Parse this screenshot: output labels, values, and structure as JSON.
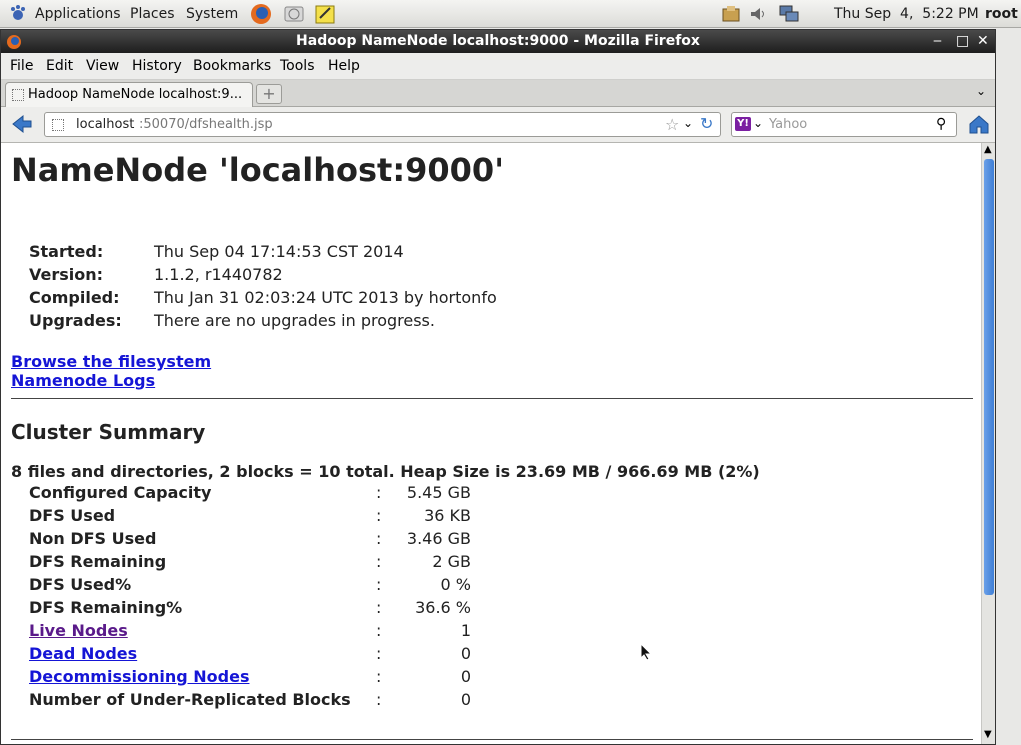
{
  "panel": {
    "applications": "Applications",
    "places": "Places",
    "system": "System",
    "clock": "Thu Sep  4,  5:22 PM",
    "user": "root"
  },
  "window": {
    "title": "Hadoop NameNode localhost:9000 - Mozilla Firefox"
  },
  "menubar": {
    "file": "File",
    "edit": "Edit",
    "view": "View",
    "history": "History",
    "bookmarks": "Bookmarks",
    "tools": "Tools",
    "help": "Help"
  },
  "tab": {
    "label": "Hadoop NameNode localhost:9..."
  },
  "navbar": {
    "url_host": "localhost",
    "url_path": ":50070/dfshealth.jsp",
    "search_placeholder": "Yahoo"
  },
  "page": {
    "title": "NameNode 'localhost:9000'",
    "info": [
      {
        "label": "Started:",
        "value": "Thu Sep 04 17:14:53 CST 2014"
      },
      {
        "label": "Version:",
        "value": "1.1.2, r1440782"
      },
      {
        "label": "Compiled:",
        "value": "Thu Jan 31 02:03:24 UTC 2013 by hortonfo"
      },
      {
        "label": "Upgrades:",
        "value": "There are no upgrades in progress."
      }
    ],
    "link_browse": "Browse the filesystem",
    "link_logs": "Namenode Logs",
    "cluster_title": "Cluster Summary",
    "summary_line": "8 files and directories, 2 blocks = 10 total. Heap Size is 23.69 MB / 966.69 MB (2%)",
    "colon": ":",
    "rows": [
      {
        "label": "Configured Capacity",
        "value": "5.45 GB"
      },
      {
        "label": "DFS Used",
        "value": "36 KB"
      },
      {
        "label": "Non DFS Used",
        "value": "3.46 GB"
      },
      {
        "label": "DFS Remaining",
        "value": "2 GB"
      },
      {
        "label": "DFS Used%",
        "value": "0 %"
      },
      {
        "label": "DFS Remaining%",
        "value": "36.6 %"
      },
      {
        "label": "Live Nodes",
        "value": "1"
      },
      {
        "label": "Dead Nodes",
        "value": "0"
      },
      {
        "label": "Decommissioning Nodes",
        "value": "0"
      },
      {
        "label": "Number of Under-Replicated Blocks",
        "value": "0"
      }
    ]
  },
  "colors": {
    "link": "#1515d6",
    "visited_link": "#5a1a8a",
    "titlebar": "#2a2a2a",
    "scroll_thumb": "#4a89dc"
  }
}
